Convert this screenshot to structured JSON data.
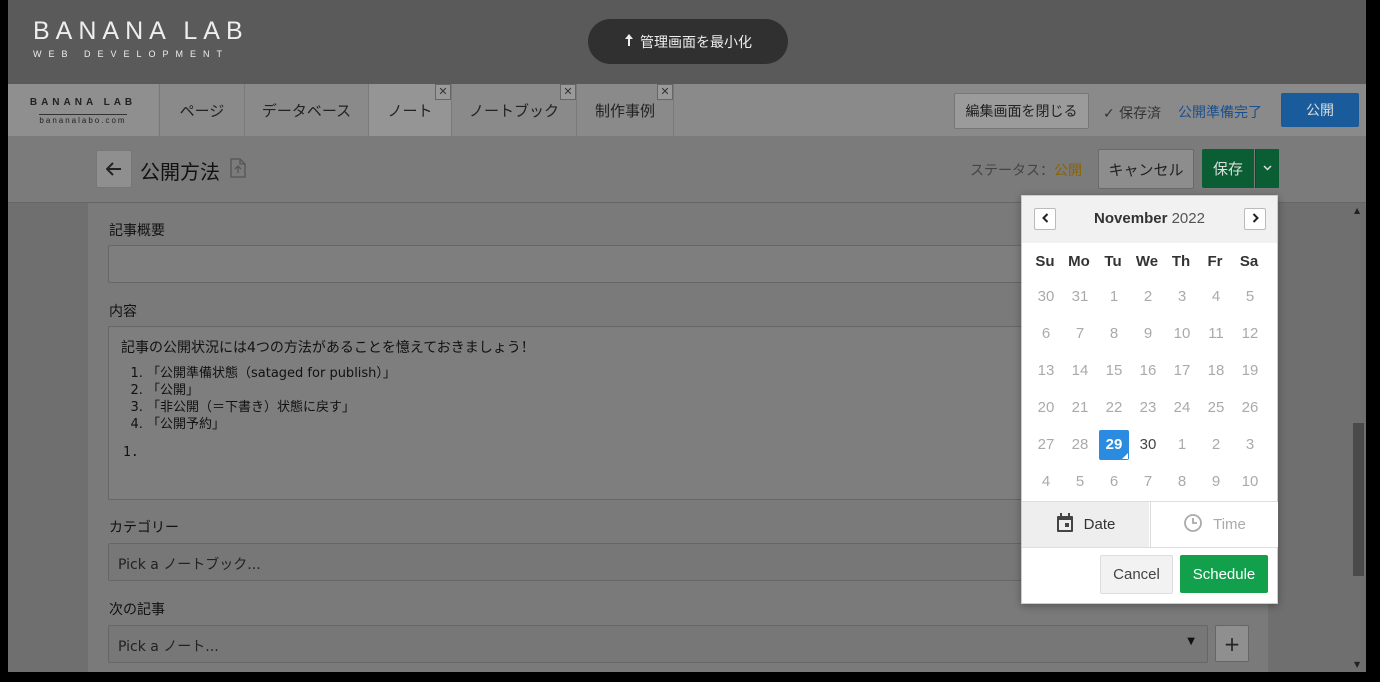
{
  "topbar": {
    "logo_title": "BANANA LAB",
    "logo_sub": "WEB DEVELOPMENT",
    "minimize_label": "管理画面を最小化"
  },
  "nav": {
    "logo_title": "BANANA LAB",
    "logo_sub": "bananalabo.com",
    "tabs": [
      {
        "label": "ページ",
        "closable": false
      },
      {
        "label": "データベース",
        "closable": false
      },
      {
        "label": "ノート",
        "closable": true,
        "active": true
      },
      {
        "label": "ノートブック",
        "closable": true
      },
      {
        "label": "制作事例",
        "closable": true
      }
    ],
    "close_tab_glyph": "✕",
    "close_edit_label": "編集画面を閉じる",
    "saved_label": "✓ 保存済",
    "ready_label": "公開準備完了",
    "publish_label": "公開"
  },
  "header": {
    "title": "公開方法",
    "status_label": "ステータス：",
    "status_value": "公開",
    "cancel_label": "キャンセル",
    "save_label": "保存"
  },
  "form": {
    "summary_label": "記事概要",
    "content_label": "内容",
    "content_intro": "記事の公開状況には4つの方法があることを憶えておきましょう！",
    "content_items": [
      "「公開準備状態（sataged for publish）」",
      "「公開」",
      "「非公開（＝下書き）状態に戻す」",
      "「公開予約」"
    ],
    "content_trailing": "1.",
    "category_label": "カテゴリー",
    "category_placeholder": "Pick a ノートブック...",
    "next_label": "次の記事",
    "next_placeholder": "Pick a ノート...",
    "plus_label": "+"
  },
  "datepicker": {
    "month": "November",
    "year": "2022",
    "weekdays": [
      "Su",
      "Mo",
      "Tu",
      "We",
      "Th",
      "Fr",
      "Sa"
    ],
    "weeks": [
      [
        "30",
        "31",
        "1",
        "2",
        "3",
        "4",
        "5"
      ],
      [
        "6",
        "7",
        "8",
        "9",
        "10",
        "11",
        "12"
      ],
      [
        "13",
        "14",
        "15",
        "16",
        "17",
        "18",
        "19"
      ],
      [
        "20",
        "21",
        "22",
        "23",
        "24",
        "25",
        "26"
      ],
      [
        "27",
        "28",
        "29",
        "30",
        "1",
        "2",
        "3"
      ],
      [
        "4",
        "5",
        "6",
        "7",
        "8",
        "9",
        "10"
      ]
    ],
    "selected": "29",
    "current_month_enabled": [
      "29",
      "30"
    ],
    "tab_date": "Date",
    "tab_time": "Time",
    "cancel_label": "Cancel",
    "schedule_label": "Schedule",
    "accent": "#2a8be0",
    "schedule_color": "#13a04d"
  }
}
